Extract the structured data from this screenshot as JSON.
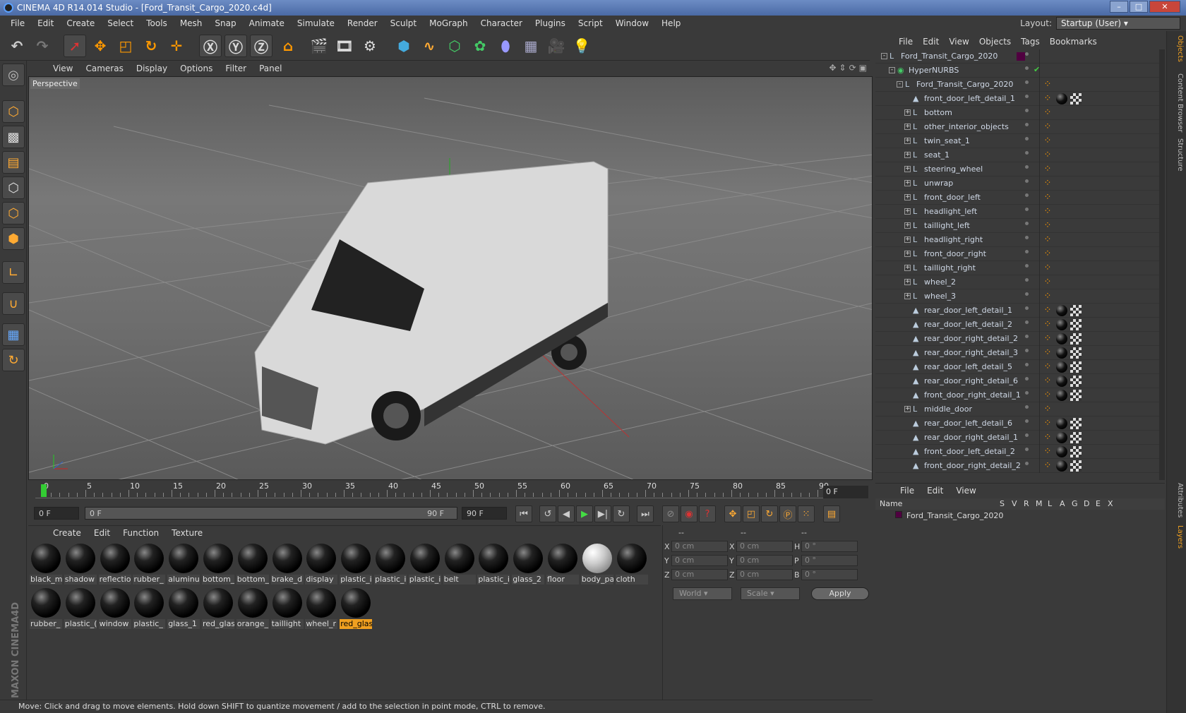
{
  "window": {
    "title": "CINEMA 4D R14.014 Studio - [Ford_Transit_Cargo_2020.c4d]"
  },
  "menubar": [
    "File",
    "Edit",
    "Create",
    "Select",
    "Tools",
    "Mesh",
    "Snap",
    "Animate",
    "Simulate",
    "Render",
    "Sculpt",
    "MoGraph",
    "Character",
    "Plugins",
    "Script",
    "Window",
    "Help"
  ],
  "layout": {
    "label": "Layout:",
    "value": "Startup (User)"
  },
  "viewport": {
    "menu": [
      "View",
      "Cameras",
      "Display",
      "Options",
      "Filter",
      "Panel"
    ],
    "label": "Perspective"
  },
  "timeline": {
    "ticks": [
      "0",
      "5",
      "10",
      "15",
      "20",
      "25",
      "30",
      "35",
      "40",
      "45",
      "50",
      "55",
      "60",
      "65",
      "70",
      "75",
      "80",
      "85",
      "90"
    ],
    "current_frame": "0 F",
    "start_field": "0 F",
    "range_start": "0 F",
    "range_end": "90 F",
    "end_field": "90 F"
  },
  "materials": {
    "menu": [
      "Create",
      "Edit",
      "Function",
      "Texture"
    ],
    "items": [
      {
        "name": "black_m"
      },
      {
        "name": "shadow"
      },
      {
        "name": "reflectio"
      },
      {
        "name": "rubber_"
      },
      {
        "name": "aluminu"
      },
      {
        "name": "bottom_"
      },
      {
        "name": "bottom_"
      },
      {
        "name": "brake_d"
      },
      {
        "name": "display"
      },
      {
        "name": "plastic_i"
      },
      {
        "name": "plastic_i"
      },
      {
        "name": "plastic_i"
      },
      {
        "name": "belt"
      },
      {
        "name": "plastic_i"
      },
      {
        "name": "glass_2"
      },
      {
        "name": "floor"
      },
      {
        "name": "body_pa"
      },
      {
        "name": "cloth"
      },
      {
        "name": "rubber_"
      },
      {
        "name": "plastic_("
      },
      {
        "name": "window"
      },
      {
        "name": "plastic_"
      },
      {
        "name": "glass_1"
      },
      {
        "name": "red_glas"
      },
      {
        "name": "orange_"
      },
      {
        "name": "taillight"
      },
      {
        "name": "wheel_r"
      },
      {
        "name": "red_glas"
      }
    ],
    "selected_index": 27
  },
  "coords": {
    "headers": [
      "--",
      "--",
      "--"
    ],
    "rows": [
      {
        "a": "X",
        "av": "0 cm",
        "b": "X",
        "bv": "0 cm",
        "c": "H",
        "cv": "0 °"
      },
      {
        "a": "Y",
        "av": "0 cm",
        "b": "Y",
        "bv": "0 cm",
        "c": "P",
        "cv": "0 °"
      },
      {
        "a": "Z",
        "av": "0 cm",
        "b": "Z",
        "bv": "0 cm",
        "c": "B",
        "cv": "0 °"
      }
    ],
    "mode": "World",
    "scale": "Scale",
    "apply": "Apply"
  },
  "status": "Move: Click and drag to move elements. Hold down SHIFT to quantize movement / add to the selection in point mode, CTRL to remove.",
  "objects": {
    "menu": [
      "File",
      "Edit",
      "View",
      "Objects",
      "Tags",
      "Bookmarks"
    ],
    "rows": [
      {
        "name": "Ford_Transit_Cargo_2020",
        "indent": 0,
        "icon": "null",
        "expand": "-",
        "tags": [
          "swatch"
        ]
      },
      {
        "name": "HyperNURBS",
        "indent": 1,
        "icon": "nurbs",
        "expand": "-",
        "tags": [
          "check-mark"
        ]
      },
      {
        "name": "Ford_Transit_Cargo_2020",
        "indent": 2,
        "icon": "null",
        "expand": "-",
        "tags": [
          "orange"
        ]
      },
      {
        "name": "front_door_left_detail_1",
        "indent": 3,
        "icon": "poly",
        "expand": "",
        "tags": [
          "orange",
          "ball",
          "check"
        ]
      },
      {
        "name": "bottom",
        "indent": 3,
        "icon": "null",
        "expand": "+",
        "tags": [
          "orange"
        ]
      },
      {
        "name": "other_interior_objects",
        "indent": 3,
        "icon": "null",
        "expand": "+",
        "tags": [
          "orange"
        ]
      },
      {
        "name": "twin_seat_1",
        "indent": 3,
        "icon": "null",
        "expand": "+",
        "tags": [
          "orange"
        ]
      },
      {
        "name": "seat_1",
        "indent": 3,
        "icon": "null",
        "expand": "+",
        "tags": [
          "orange"
        ]
      },
      {
        "name": "steering_wheel",
        "indent": 3,
        "icon": "null",
        "expand": "+",
        "tags": [
          "orange"
        ]
      },
      {
        "name": "unwrap",
        "indent": 3,
        "icon": "null",
        "expand": "+",
        "tags": [
          "orange"
        ]
      },
      {
        "name": "front_door_left",
        "indent": 3,
        "icon": "null",
        "expand": "+",
        "tags": [
          "orange"
        ]
      },
      {
        "name": "headlight_left",
        "indent": 3,
        "icon": "null",
        "expand": "+",
        "tags": [
          "orange"
        ]
      },
      {
        "name": "taillight_left",
        "indent": 3,
        "icon": "null",
        "expand": "+",
        "tags": [
          "orange"
        ]
      },
      {
        "name": "headlight_right",
        "indent": 3,
        "icon": "null",
        "expand": "+",
        "tags": [
          "orange"
        ]
      },
      {
        "name": "front_door_right",
        "indent": 3,
        "icon": "null",
        "expand": "+",
        "tags": [
          "orange"
        ]
      },
      {
        "name": "taillight_right",
        "indent": 3,
        "icon": "null",
        "expand": "+",
        "tags": [
          "orange"
        ]
      },
      {
        "name": "wheel_2",
        "indent": 3,
        "icon": "null",
        "expand": "+",
        "tags": [
          "orange"
        ]
      },
      {
        "name": "wheel_3",
        "indent": 3,
        "icon": "null",
        "expand": "+",
        "tags": [
          "orange"
        ]
      },
      {
        "name": "rear_door_left_detail_1",
        "indent": 3,
        "icon": "poly",
        "expand": "",
        "tags": [
          "orange",
          "ball",
          "check"
        ]
      },
      {
        "name": "rear_door_left_detail_2",
        "indent": 3,
        "icon": "poly",
        "expand": "",
        "tags": [
          "orange",
          "ball",
          "check"
        ]
      },
      {
        "name": "rear_door_right_detail_2",
        "indent": 3,
        "icon": "poly",
        "expand": "",
        "tags": [
          "orange",
          "ball",
          "check"
        ]
      },
      {
        "name": "rear_door_right_detail_3",
        "indent": 3,
        "icon": "poly",
        "expand": "",
        "tags": [
          "orange",
          "ball",
          "check"
        ]
      },
      {
        "name": "rear_door_left_detail_5",
        "indent": 3,
        "icon": "poly",
        "expand": "",
        "tags": [
          "orange",
          "ball",
          "check"
        ]
      },
      {
        "name": "rear_door_right_detail_6",
        "indent": 3,
        "icon": "poly",
        "expand": "",
        "tags": [
          "orange",
          "ball",
          "check"
        ]
      },
      {
        "name": "front_door_right_detail_1",
        "indent": 3,
        "icon": "poly",
        "expand": "",
        "tags": [
          "orange",
          "ball",
          "check"
        ]
      },
      {
        "name": "middle_door",
        "indent": 3,
        "icon": "null",
        "expand": "+",
        "tags": [
          "orange"
        ]
      },
      {
        "name": "rear_door_left_detail_6",
        "indent": 3,
        "icon": "poly",
        "expand": "",
        "tags": [
          "orange",
          "ball",
          "check"
        ]
      },
      {
        "name": "rear_door_right_detail_1",
        "indent": 3,
        "icon": "poly",
        "expand": "",
        "tags": [
          "orange",
          "ball",
          "check"
        ]
      },
      {
        "name": "front_door_left_detail_2",
        "indent": 3,
        "icon": "poly",
        "expand": "",
        "tags": [
          "orange",
          "ball",
          "check"
        ]
      },
      {
        "name": "front_door_right_detail_2",
        "indent": 3,
        "icon": "poly",
        "expand": "",
        "tags": [
          "orange",
          "ball",
          "check"
        ]
      }
    ]
  },
  "layers": {
    "menu": [
      "File",
      "Edit",
      "View"
    ],
    "columns": [
      "Name",
      "S",
      "V",
      "R",
      "M",
      "L",
      "A",
      "G",
      "D",
      "E",
      "X"
    ],
    "row_name": "Ford_Transit_Cargo_2020"
  },
  "right_tabs": [
    "Objects",
    "Content Browser",
    "Structure",
    "Attributes",
    "Layers"
  ],
  "colors": {
    "accent": "#f0a020",
    "panel": "#3a3a3a",
    "title": "#5a78b5"
  }
}
